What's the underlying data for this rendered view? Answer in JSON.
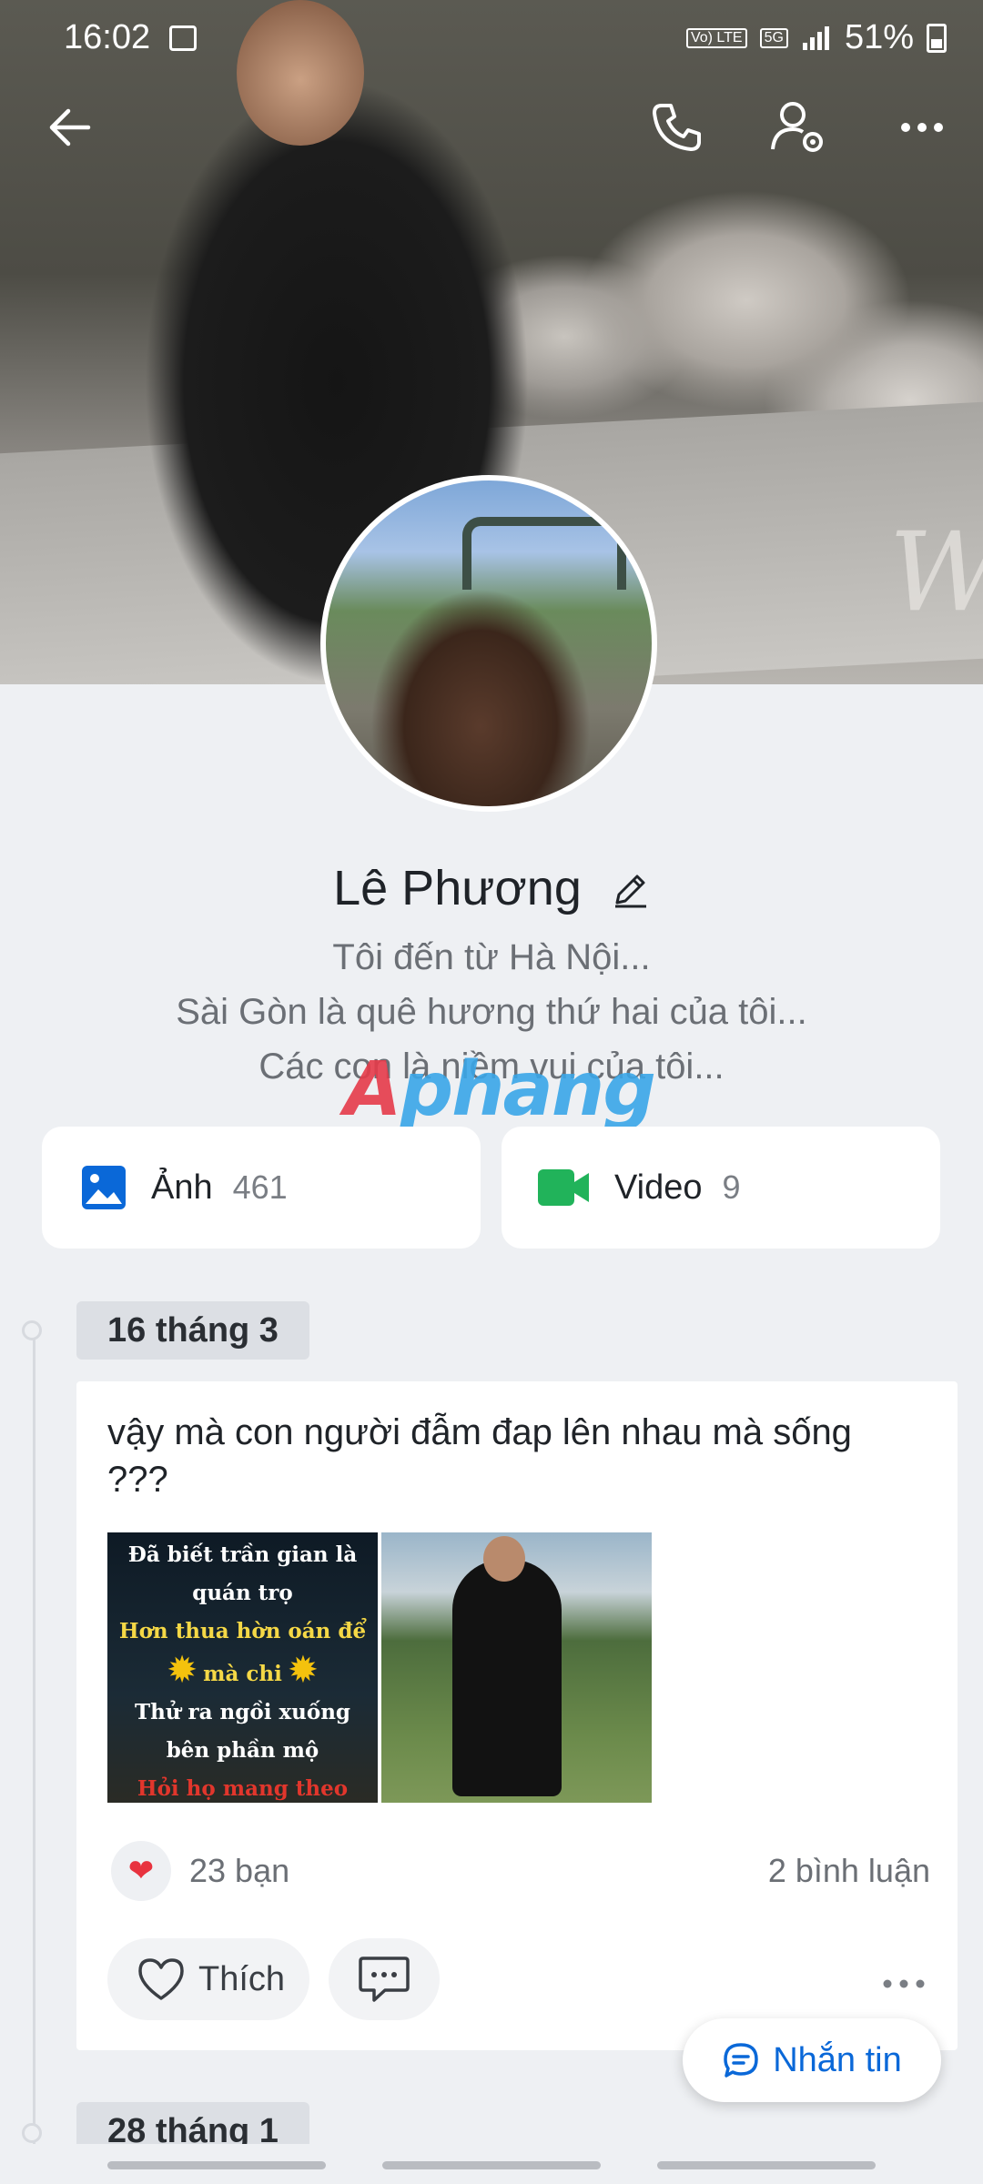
{
  "status_bar": {
    "time": "16:02",
    "network_tag": "Vo) LTE",
    "network_type": "5G",
    "battery": "51%"
  },
  "header_icons": [
    "back-arrow-icon",
    "phone-icon",
    "user-settings-icon",
    "more-icon"
  ],
  "profile": {
    "name": "Lê Phương",
    "bio_lines": [
      "Tôi đến từ Hà Nội...",
      "Sài Gòn là quê hương thứ hai của tôi...",
      "Các con là niềm vui của tôi..."
    ]
  },
  "watermark": {
    "first": "A",
    "rest": "phang"
  },
  "media": {
    "photos": {
      "label": "Ảnh",
      "count": "461",
      "icon": "image-icon",
      "color": "#0a68d8"
    },
    "videos": {
      "label": "Video",
      "count": "9",
      "icon": "video-camera-icon",
      "color": "#21b35a"
    }
  },
  "timeline": {
    "date1": "16 tháng 3",
    "date2": "28 tháng 1"
  },
  "post": {
    "text": "vậy mà con người đẫm  đap lên nhau mà sống ???",
    "image1_lines": {
      "l1": "Đã biết trần gian là",
      "l2": "quán trọ",
      "l3": "Hơn thua hờn oán để",
      "l4": "mà chi",
      "l5": "Thử ra ngồi xuống",
      "l6": "bên phần mộ",
      "l7": "Hỏi họ mang theo"
    },
    "reactions": "23 bạn",
    "comments": "2 bình luận",
    "like_label": "Thích"
  },
  "message_button": "Nhắn tin",
  "colors": {
    "accent": "#0a68d8",
    "heart": "#e8333f",
    "background": "#eef0f3"
  }
}
